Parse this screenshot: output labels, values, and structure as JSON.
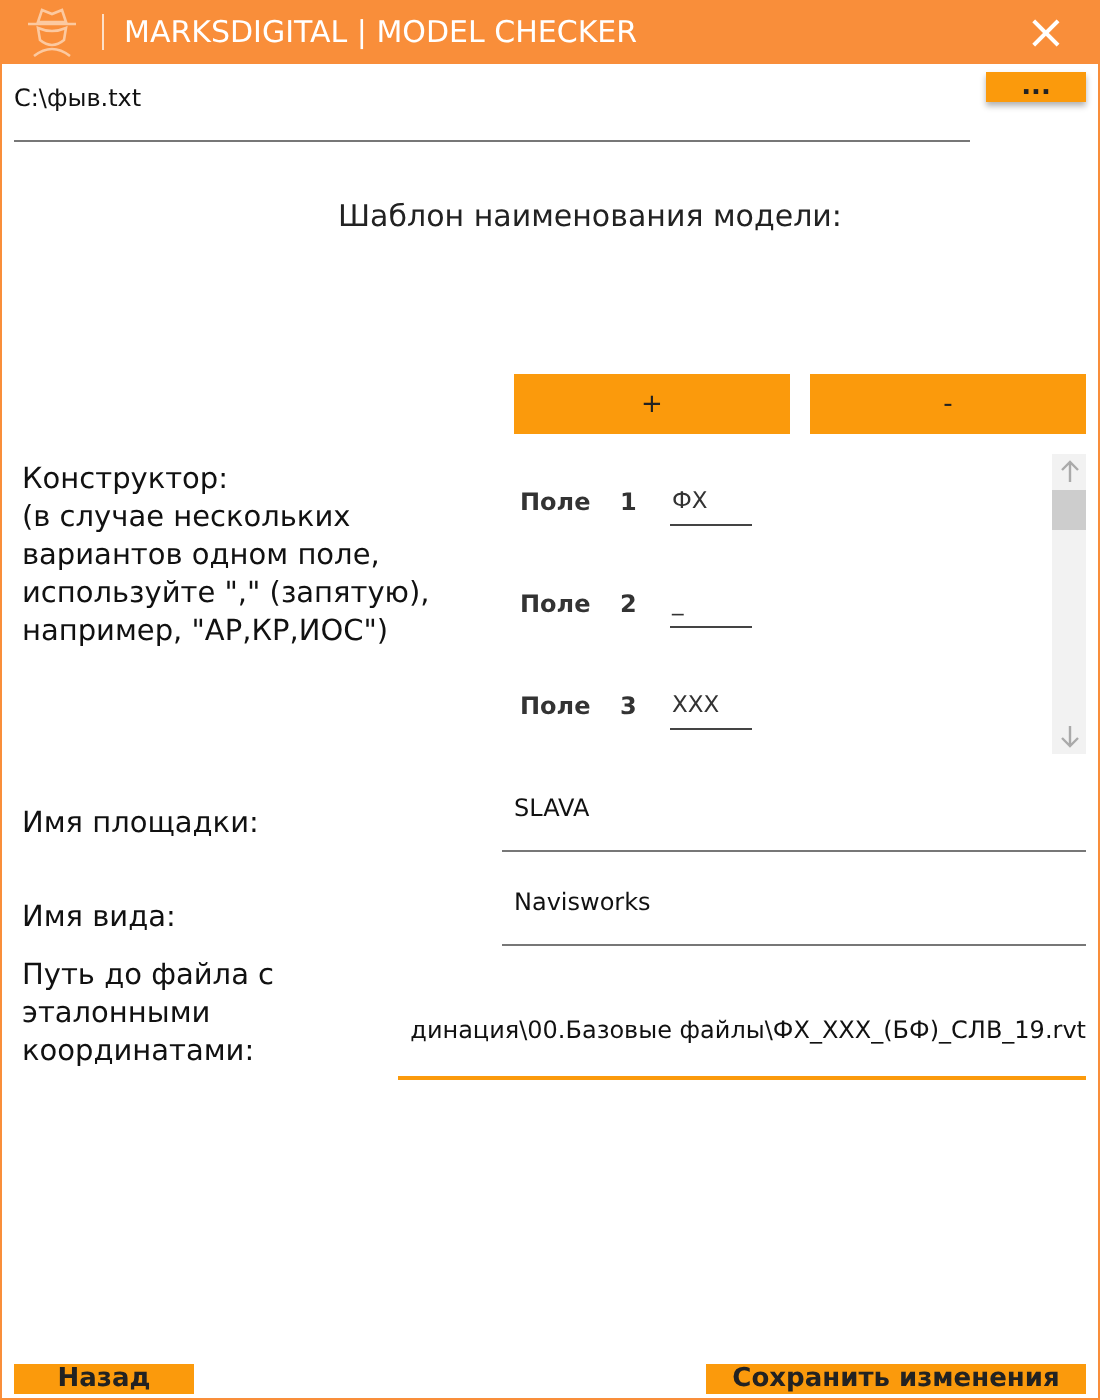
{
  "window": {
    "title": "MARKSDIGITAL | MODEL CHECKER",
    "close": "×"
  },
  "file_field": {
    "value": "C:\\фыв.txt",
    "browse_button": "..."
  },
  "template_heading": "Шаблон наименования модели:",
  "add_button": "+",
  "remove_button": "-",
  "designer": {
    "label": "Конструктор:\n(в случае нескольких вариантов одном поле, используйте \",\" (запятую), например, \"АР,КР,ИОС\")",
    "fields": [
      {
        "label": "Поле",
        "number": "1",
        "value": "ФХ"
      },
      {
        "label": "Поле",
        "number": "2",
        "value": "_"
      },
      {
        "label": "Поле",
        "number": "3",
        "value": "XXX"
      }
    ]
  },
  "settings": [
    {
      "label": "Имя площадки:",
      "value": "SLAVA",
      "focused": false
    },
    {
      "label": "Имя вида:",
      "value": "Navisworks",
      "focused": false
    },
    {
      "label": "Путь до файла с эталонными координатами:",
      "value": "динация\\00.Базовые файлы\\ФХ_XXX_(БФ)_СЛВ_19.rvt",
      "focused": true
    }
  ],
  "footer": {
    "back_button": "Назад",
    "save_button": "Сохранить изменения"
  }
}
